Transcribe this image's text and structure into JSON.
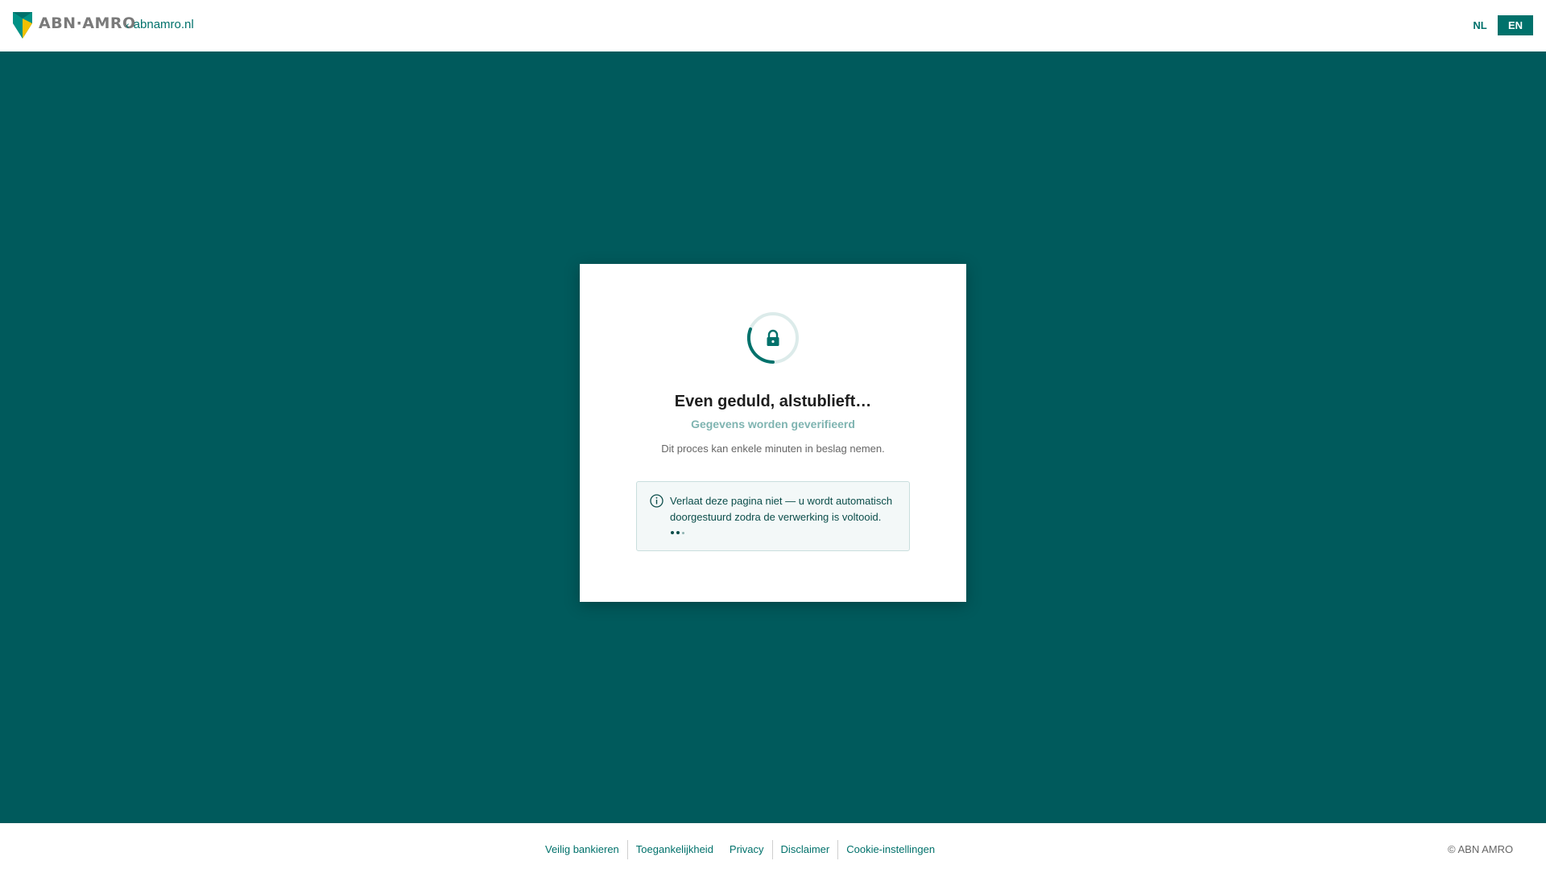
{
  "header": {
    "logo_text": "ABN·AMRO",
    "back_link": "abnamro.nl",
    "lang_nl": "NL",
    "lang_en": "EN",
    "active_lang": "EN"
  },
  "card": {
    "icon": "lock-icon",
    "title": "Even geduld, alstublieft…",
    "subtitle": "Gegevens worden geverifieerd",
    "note": "Dit proces kan enkele minuten in beslag nemen.",
    "info": {
      "icon": "info-icon",
      "text": "Verlaat deze pagina niet — u wordt automatisch doorgestuurd zodra de verwerking is voltooid."
    }
  },
  "footer": {
    "links": [
      "Veilig bankieren",
      "Toegankelijkheid",
      "Privacy",
      "Disclaimer",
      "Cookie-instellingen"
    ],
    "copyright": "© ABN AMRO"
  },
  "colors": {
    "brand": "#00716b",
    "background": "#005a5c",
    "logo_green": "#009286",
    "logo_yellow": "#f3c000"
  }
}
